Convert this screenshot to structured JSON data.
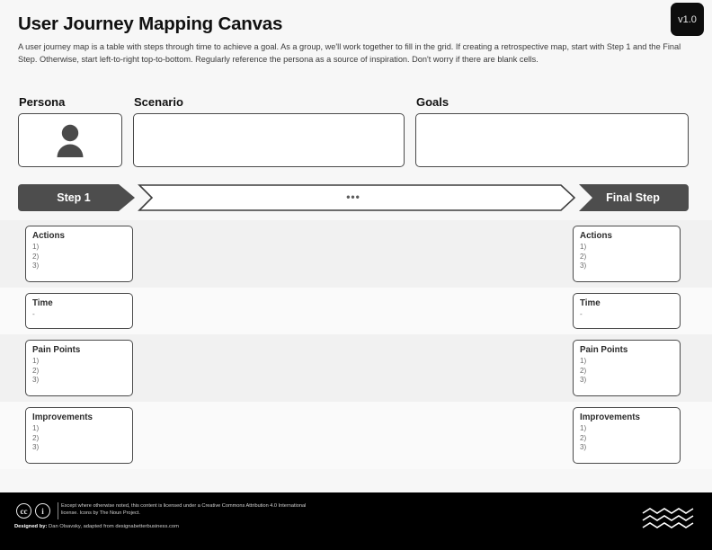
{
  "version": {
    "label": "v1.0"
  },
  "header": {
    "title": "User Journey Mapping Canvas",
    "subtitle": "A user journey map is a table with steps through time to achieve a goal. As a group, we'll work together to fill in the grid. If creating a retrospective map, start with Step 1 and the Final Step. Otherwise, start left-to-right top-to-bottom. Regularly reference the persona as a source of inspiration. Don't worry if there are blank cells."
  },
  "toprow": {
    "persona": {
      "label": "Persona",
      "icon": "person-avatar-icon",
      "value": ""
    },
    "scenario": {
      "label": "Scenario",
      "value": "",
      "placeholder": ""
    },
    "goals": {
      "label": "Goals",
      "value": "",
      "placeholder": ""
    }
  },
  "stepbar": {
    "first_step": "Step 1",
    "middle_dots": "•••",
    "final_step": "Final Step"
  },
  "grid": {
    "rows": [
      {
        "name": "actions",
        "title": "Actions",
        "items": [
          "1)",
          "2)",
          "3)"
        ],
        "band": true,
        "height": "tall"
      },
      {
        "name": "time",
        "title": "Time",
        "items": [
          "-"
        ],
        "band": false,
        "height": "short"
      },
      {
        "name": "pain-points",
        "title": "Pain Points",
        "items": [
          "1)",
          "2)",
          "3)"
        ],
        "band": true,
        "height": "tall"
      },
      {
        "name": "improvements",
        "title": "Improvements",
        "items": [
          "1)",
          "2)",
          "3)"
        ],
        "band": false,
        "height": "tall"
      }
    ]
  },
  "footer": {
    "cc_icons": [
      "cc-circle-icon",
      "cc-by-person-icon"
    ],
    "cc_glyph_1": "cc",
    "cc_glyph_2": "ⓘ",
    "license_text": "Except where otherwise noted, this content is licensed under a Creative Commons Attribution 4.0 International license. Icons by The Noun Project.",
    "designed_prefix": "Designed by:",
    "designed_text": "Dan Olsavsky,  adapted from designabetterbusiness.com",
    "logo": "wave-lines-logo"
  },
  "colors": {
    "page_background": "#f7f7f7",
    "footer_background": "#000000",
    "step_fill": "#4d4d4d",
    "border": "#4a4a4a",
    "band_row": "#f1f1f1",
    "plain_row": "#fafafa"
  }
}
